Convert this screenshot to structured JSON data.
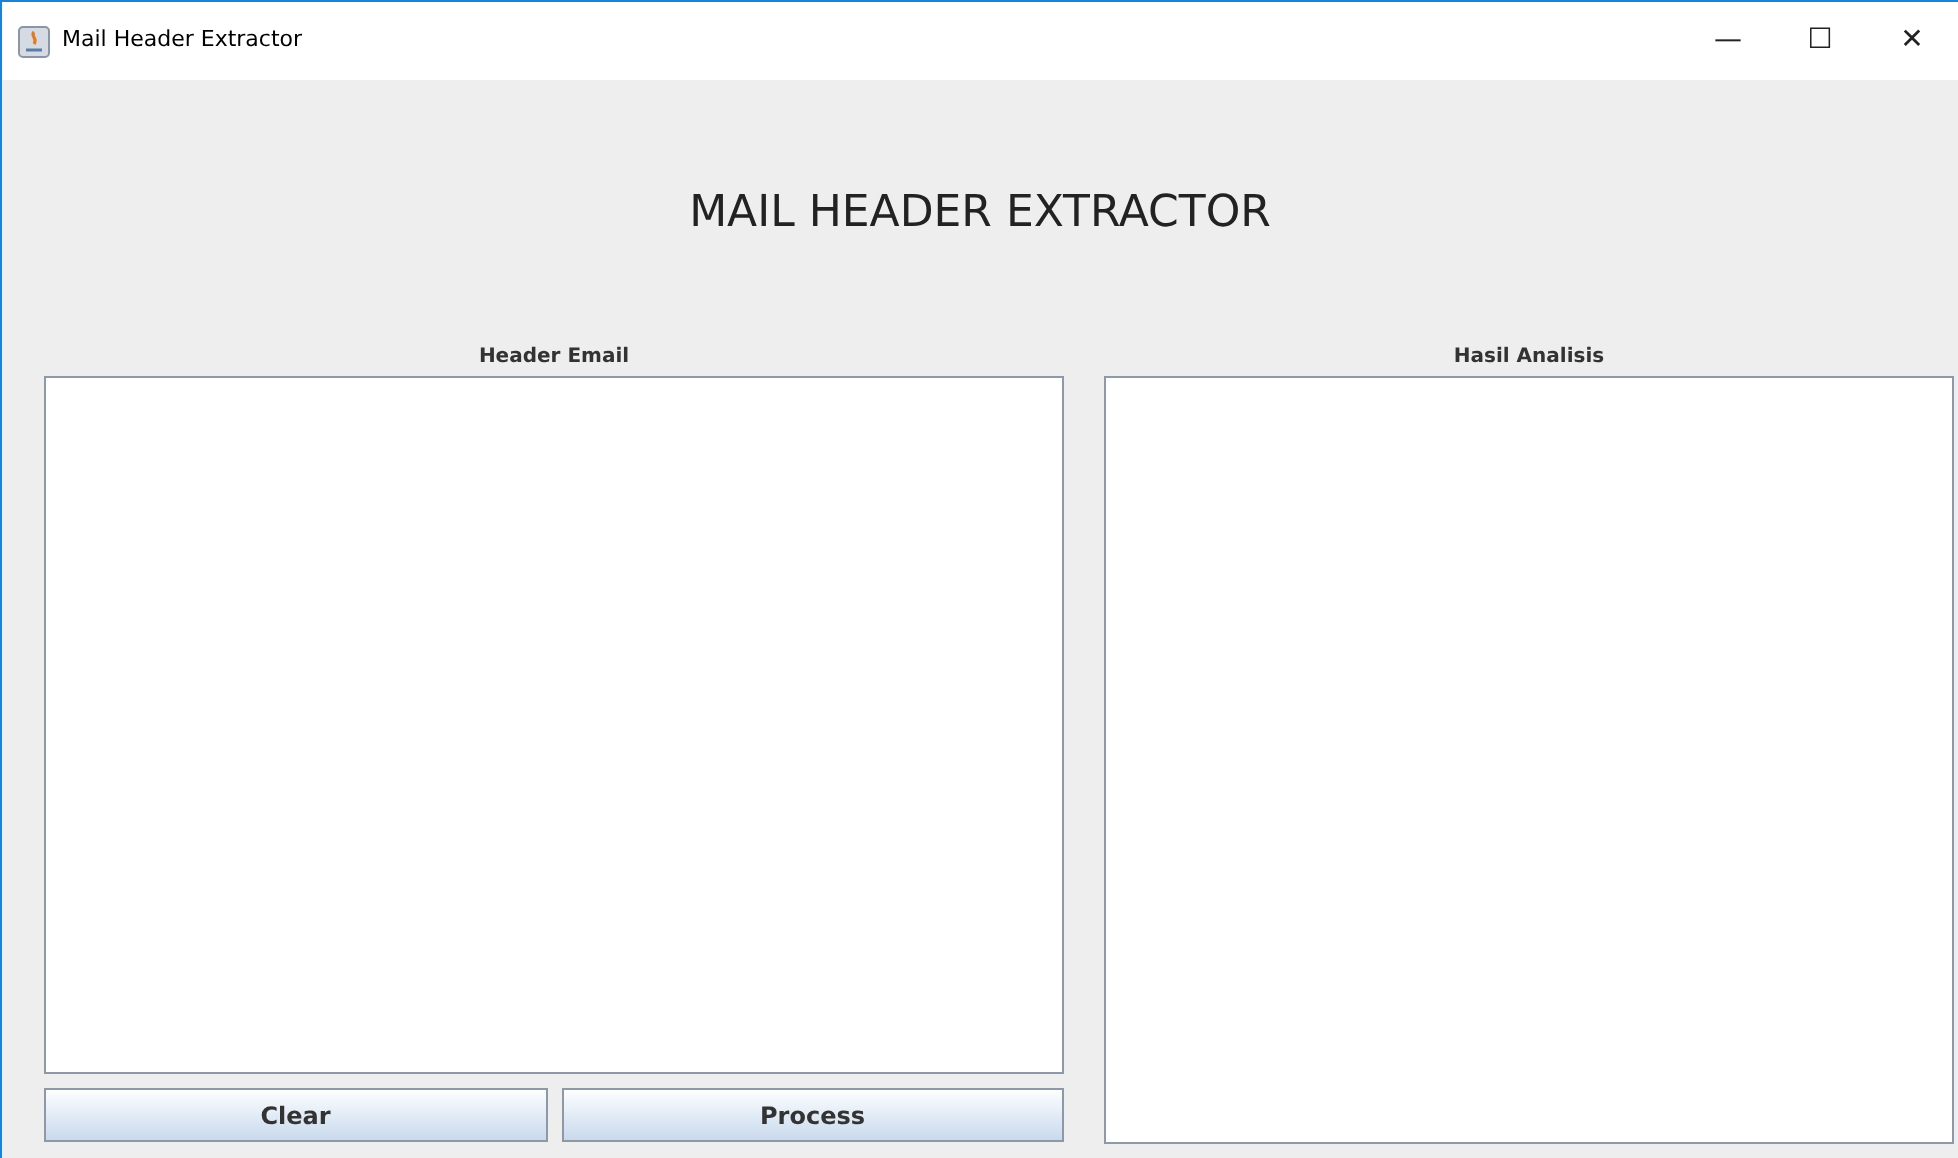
{
  "window": {
    "title": "Mail Header Extractor",
    "controls": [
      "—",
      "☐",
      "✕"
    ]
  },
  "heading": "MAIL HEADER EXTRACTOR",
  "panels": [
    {
      "label": "Header Email"
    },
    {
      "label": "Hasil Analisis"
    }
  ],
  "buttons": [
    "Clear",
    "Process"
  ]
}
